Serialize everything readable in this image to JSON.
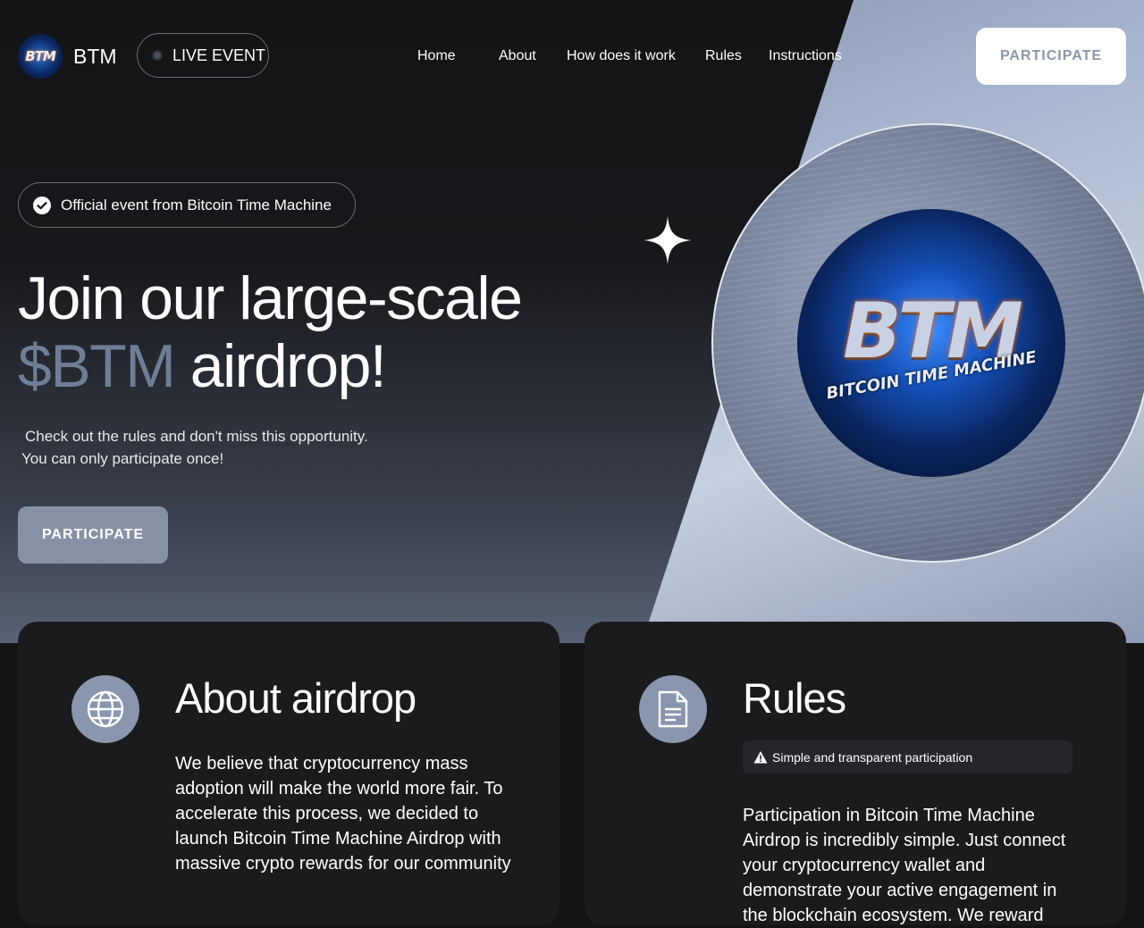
{
  "header": {
    "logo_text": "BTM",
    "brand": "BTM",
    "live_label": "LIVE EVENT",
    "nav": [
      {
        "label": "Home"
      },
      {
        "label": "About"
      },
      {
        "label": "How does it work"
      },
      {
        "label": "Rules"
      },
      {
        "label": "Instructions"
      }
    ],
    "cta_label": "PARTICIPATE"
  },
  "hero": {
    "badge": "Official event from Bitcoin Time Machine",
    "title_line1": "Join our large-scale",
    "title_accent": "$BTM",
    "title_rest": " airdrop!",
    "subtitle_line1": "Check out the rules and don't miss this opportunity.",
    "subtitle_line2": "You can only participate once!",
    "cta_label": "PARTICIPATE",
    "medal_big": "BTM",
    "medal_small": "BITCOIN TIME MACHINE"
  },
  "about": {
    "title": "About airdrop",
    "body": "We believe that cryptocurrency mass adoption will make the world more fair. To accelerate this process, we decided to launch Bitcoin Time Machine Airdrop with massive crypto rewards for our community"
  },
  "rules": {
    "title": "Rules",
    "notice": "Simple and transparent participation",
    "body": "Participation in Bitcoin Time Machine Airdrop is incredibly simple. Just connect your cryptocurrency wallet and demonstrate your active engagement in the blockchain ecosystem. We reward"
  },
  "colors": {
    "accent": "#6f7d97",
    "button_muted": "#8791a6",
    "icon_bg": "#8a96ad",
    "card_bg": "#1b1b1e"
  },
  "icons": [
    "logo-medal",
    "live-dot-icon",
    "verified-check-icon",
    "sparkle-star-icon",
    "globe-icon",
    "document-icon",
    "warning-icon"
  ]
}
